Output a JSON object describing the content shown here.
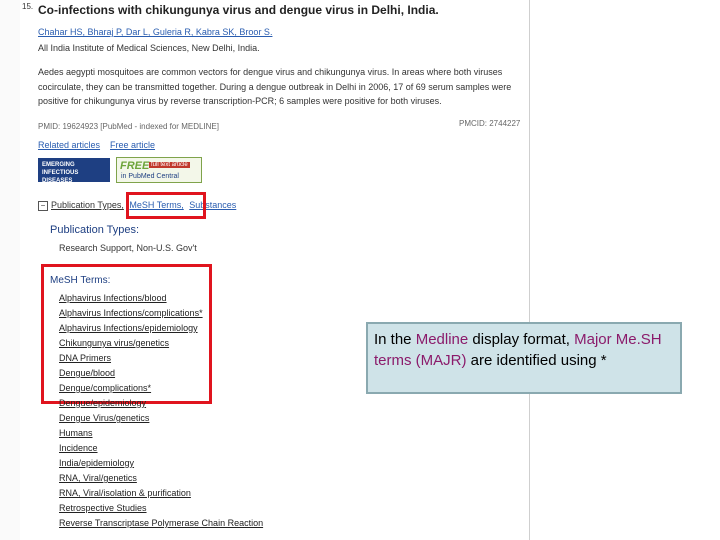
{
  "result_number": "15.",
  "title": "Co-infections with chikungunya virus and dengue virus in Delhi, India.",
  "authors": "Chahar HS, Bharaj P, Dar L, Guleria R, Kabra SK, Broor S.",
  "affiliation": "All India Institute of Medical Sciences, New Delhi, India.",
  "abstract_lines": [
    "Aedes aegypti mosquitoes are common vectors for dengue virus and chikungunya virus. In areas where both viruses",
    "cocirculate, they can be transmitted together. During a dengue outbreak in Delhi in 2006, 17 of 69 serum samples were",
    "positive for chikungunya virus by reverse transcription-PCR; 6 samples were positive for both viruses."
  ],
  "pmid_line": "PMID: 19624923 [PubMed - indexed for MEDLINE]",
  "pmcid": "PMCID: 2744227",
  "links": {
    "related": "Related articles",
    "free": "Free article"
  },
  "logo_eid": {
    "line1": "EMERGING",
    "line2": "INFECTIOUS DISEASES"
  },
  "logo_pmc": {
    "free": "FREE",
    "fulltext": "full text article",
    "pmc": "in PubMed Central"
  },
  "tabs": {
    "pubtypes": "Publication Types,",
    "mesh": "MeSH Terms,",
    "substances": "Substances"
  },
  "pubtypes_heading": "Publication Types:",
  "pubtypes_value": "Research Support, Non-U.S. Gov't",
  "mesh_heading": "MeSH Terms:",
  "mesh_terms": [
    "Alphavirus Infections/blood",
    "Alphavirus Infections/complications*",
    "Alphavirus Infections/epidemiology",
    "Chikungunya virus/genetics",
    "DNA Primers",
    "Dengue/blood",
    "Dengue/complications*",
    "Dengue/epidemiology",
    "Dengue Virus/genetics",
    "Humans",
    "Incidence",
    "India/epidemiology",
    "RNA, Viral/genetics",
    "RNA, Viral/isolation & purification",
    "Retrospective Studies",
    "Reverse Transcriptase Polymerase Chain Reaction"
  ],
  "callout": {
    "t1": "In the ",
    "t2": "Medline",
    "t3": " display format, ",
    "t4": "Major Me.SH terms (MAJR)",
    "t5": " are identified using *"
  },
  "colors": {
    "highlight": "#e0141e",
    "link": "#2a5db0",
    "callout_bg": "#cfe3e8",
    "callout_emph": "#8b1b6b"
  }
}
